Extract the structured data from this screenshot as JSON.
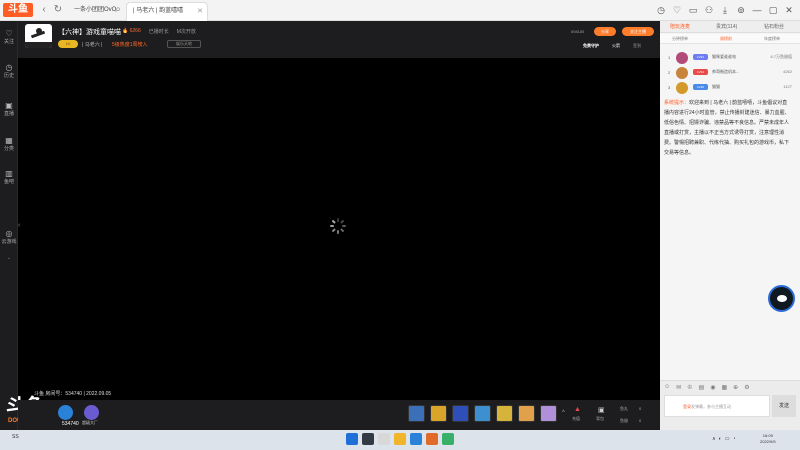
{
  "browser": {
    "logo": "斗鱼",
    "tabs": [
      {
        "label": "一条小团团OvO",
        "active": false
      },
      {
        "label": "| 马老六 | 韵蓝嘻嘻",
        "active": true
      }
    ],
    "close_glyph": "✕"
  },
  "sidebar": {
    "items": [
      {
        "icon": "♡",
        "label": "关注"
      },
      {
        "icon": "◷",
        "label": "历史"
      },
      {
        "icon": "▣",
        "label": "直播"
      },
      {
        "icon": "▦",
        "label": "分类"
      },
      {
        "icon": "▥",
        "label": "鱼吧"
      },
      {
        "icon": "◎",
        "label": "云游戏"
      }
    ]
  },
  "room": {
    "title": "【六神】游戏童喵喵",
    "popularity": "6266",
    "stat2": "已播时长",
    "stat3": "M次开放",
    "level_badge": "LV",
    "anchor": "| 马老六 |",
    "rank_text": "5级热度1周榜入",
    "category_button": "娱乐天地",
    "viewers": "698185",
    "share_label": "分享",
    "subscribe_label": "关注主播",
    "guard_label": "免费守护",
    "fans_label": "火箭",
    "report_label": "签到",
    "caption": "斗鱼 房间号：534740 | 2022.09.05",
    "watermark_big": "斗鱼",
    "watermark_small": "DOUYU.COM",
    "watermark_room": "534740"
  },
  "bottombar": {
    "icons": [
      {
        "label": "鱼丸",
        "color": "#2a82d8"
      },
      {
        "label": "超级大厂",
        "color": "#6b5bd0"
      }
    ],
    "gifts": [
      {
        "color": "#3b6fb8"
      },
      {
        "color": "#d8a52a"
      },
      {
        "color": "#2f4fb8"
      },
      {
        "color": "#3e8fd0"
      },
      {
        "color": "#d6b33a"
      },
      {
        "color": "#e0a14a"
      },
      {
        "color": "#b090d8"
      }
    ],
    "recharge": "充值",
    "backpack": "背包",
    "yuwan_label": "鱼丸",
    "yuwan_value": "0",
    "yuchi_label": "鱼翅",
    "yuchi_value": "0"
  },
  "panel": {
    "tabs": [
      {
        "label": "陪玩连麦",
        "active": true
      },
      {
        "label": "贵宾(114)",
        "active": false
      },
      {
        "label": "钻石粉丝",
        "active": false
      }
    ],
    "subtabs": [
      {
        "label": "分钟榜单",
        "active": false
      },
      {
        "label": "周榜前",
        "active": true
      },
      {
        "label": "年度榜单",
        "active": false
      }
    ],
    "ranks": [
      {
        "no": "1",
        "level": "LV34",
        "level_color": "#6d7df0",
        "name": "猫咪爱谁谁电",
        "score": "6.7万鱼翅值",
        "avatar_color": "#b24a7a"
      },
      {
        "no": "2",
        "level": "LV34",
        "level_color": "#e84a4a",
        "name": "帅哥制造机本...",
        "score": "4262",
        "avatar_color": "#c8843a"
      },
      {
        "no": "3",
        "level": "LV40",
        "level_color": "#4a8ae8",
        "name": "猫猫",
        "score": "1127",
        "avatar_color": "#d29a2a"
      }
    ],
    "notice_head": "系统提示：",
    "notice_body": "欢迎来到 | 马老六 | 韵蓝嘻嘻，斗鱼倡议对直播内容进行24小时监管，禁止传播封建迷信、暴力血腥、低俗色情、招嫖诈骗、违禁品等不良信息。严禁未成年人直播或打赏，主播以不正当方式诱导打赏，注意理性消费。警惕招聘兼职、代练代抽、购买礼包的游戏币，私下交易等信息。",
    "chat_register": "登录",
    "chat_placeholder": "发弹幕，参与主播互动",
    "send_label": "发送",
    "toolbar_icons": [
      "☺",
      "✉",
      "♔",
      "▤",
      "◉",
      "▦",
      "⊕",
      "⚙"
    ]
  },
  "taskbar": {
    "left_text": "SS",
    "tray": [
      "∧",
      "◐",
      "▭",
      "◔"
    ],
    "time": "16:09",
    "date": "2022/9/5",
    "apps": [
      {
        "color": "#1f6fd8"
      },
      {
        "color": "#333a44"
      },
      {
        "color": "#d8d8d8"
      },
      {
        "color": "#f0b52a"
      },
      {
        "color": "#2a82d8"
      },
      {
        "color": "#e06a2a"
      },
      {
        "color": "#39b06a"
      }
    ]
  }
}
